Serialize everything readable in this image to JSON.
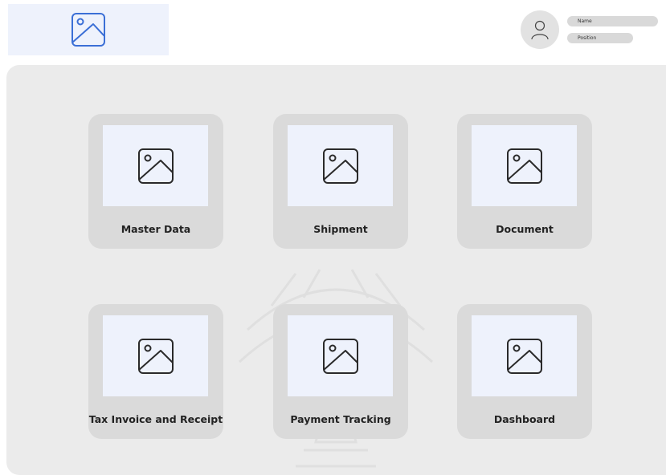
{
  "profile": {
    "name_label": "Name",
    "position_label": "Position",
    "avatar_icon": "user-icon"
  },
  "logo": {
    "icon": "image-placeholder-icon",
    "color": "#3b6fd6"
  },
  "colors": {
    "panel_bg": "#ebebeb",
    "card_bg": "#dadada",
    "thumb_bg": "#eef2fc"
  },
  "menu": [
    {
      "label": "Master Data",
      "icon": "image-placeholder-icon"
    },
    {
      "label": "Shipment",
      "icon": "image-placeholder-icon"
    },
    {
      "label": "Document",
      "icon": "image-placeholder-icon"
    },
    {
      "label": "Tax Invoice and Receipt",
      "icon": "image-placeholder-icon"
    },
    {
      "label": "Payment Tracking",
      "icon": "image-placeholder-icon"
    },
    {
      "label": "Dashboard",
      "icon": "image-placeholder-icon"
    }
  ]
}
